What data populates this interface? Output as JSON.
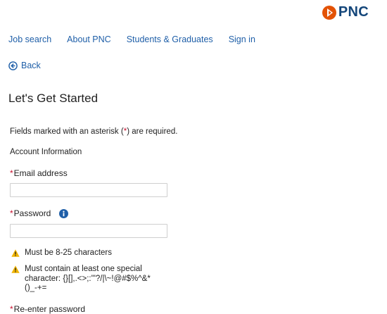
{
  "logo": {
    "text": "PNC",
    "mark_icon": "pnc-logo-mark",
    "brand_orange": "#e35205",
    "brand_blue": "#14467a"
  },
  "nav": {
    "items": [
      {
        "label": "Job search"
      },
      {
        "label": "About PNC"
      },
      {
        "label": "Students & Graduates"
      },
      {
        "label": "Sign in"
      }
    ],
    "link_color": "#1f5fa8"
  },
  "back": {
    "label": "Back",
    "icon": "arrow-left-circle-icon"
  },
  "page": {
    "title": "Let's Get Started"
  },
  "form": {
    "required_note_prefix": "Fields marked with an asterisk (",
    "required_star": "*",
    "required_note_suffix": ") are required.",
    "section_label": "Account Information",
    "required_color": "#c8102e",
    "email": {
      "star": "*",
      "label": "Email address",
      "value": ""
    },
    "password": {
      "star": "*",
      "label": "Password",
      "value": "",
      "info_icon": "info-icon"
    },
    "password_rules": [
      {
        "icon": "warning-icon",
        "lines": [
          "Must be 8-25 characters"
        ]
      },
      {
        "icon": "warning-icon",
        "lines": [
          "Must contain at least one special",
          "character: {}[],.<>;:'\"?/|\\~!@#$%^&*",
          "()_-+="
        ]
      }
    ],
    "reenter": {
      "star": "*",
      "label": "Re-enter password"
    }
  }
}
